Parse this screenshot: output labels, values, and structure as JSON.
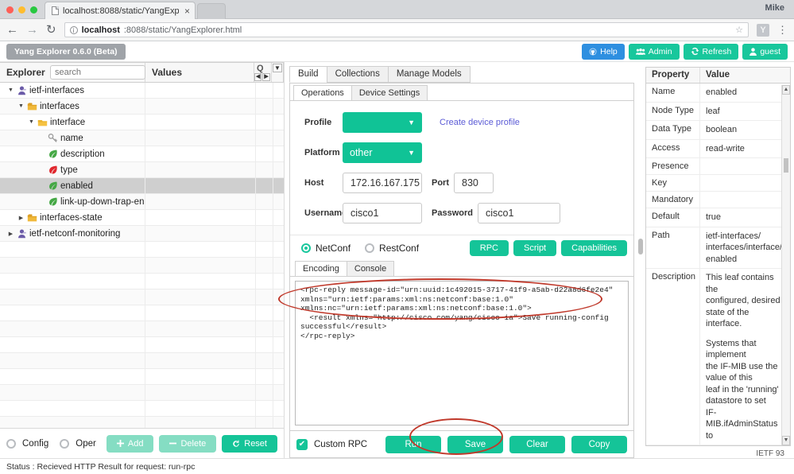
{
  "browser": {
    "tab_title": "localhost:8088/static/YangExp",
    "tab_close": "×",
    "profile": "Mike",
    "back": "←",
    "forward": "→",
    "reload": "↻",
    "info_glyph": "ⓘ",
    "url_host": "localhost",
    "url_rest": ":8088/static/YangExplorer.html",
    "star": "☆",
    "extension": "Y",
    "menu": "⋮"
  },
  "app_header": {
    "brand": "Yang Explorer 0.6.0 (Beta)",
    "buttons": [
      {
        "label": "Help",
        "icon": "github-icon",
        "color": "#2e8fe0"
      },
      {
        "label": "Admin",
        "icon": "users-icon",
        "color": "#18c79c"
      },
      {
        "label": "Refresh",
        "icon": "refresh-icon",
        "color": "#18c79c"
      },
      {
        "label": "guest",
        "icon": "user-icon",
        "color": "#18c79c"
      }
    ]
  },
  "explorer": {
    "title": "Explorer",
    "search_placeholder": "search",
    "search_value": "",
    "values_header": "Values",
    "spinner_glyph": "Q",
    "tree": [
      {
        "label": "ietf-interfaces",
        "indent": 0,
        "twisty": "▼",
        "icon": "module-icon"
      },
      {
        "label": "interfaces",
        "indent": 1,
        "twisty": "▼",
        "icon": "container-icon"
      },
      {
        "label": "interface",
        "indent": 2,
        "twisty": "▼",
        "icon": "list-icon"
      },
      {
        "label": "name",
        "indent": 3,
        "twisty": "",
        "icon": "key-icon"
      },
      {
        "label": "description",
        "indent": 3,
        "twisty": "",
        "icon": "leaf-green-icon"
      },
      {
        "label": "type",
        "indent": 3,
        "twisty": "",
        "icon": "leaf-red-icon"
      },
      {
        "label": "enabled",
        "indent": 3,
        "twisty": "",
        "icon": "leaf-green-icon",
        "selected": true
      },
      {
        "label": "link-up-down-trap-enable",
        "indent": 3,
        "twisty": "",
        "icon": "leaf-green-icon"
      },
      {
        "label": "interfaces-state",
        "indent": 1,
        "twisty": "▶",
        "icon": "container-icon"
      },
      {
        "label": "ietf-netconf-monitoring",
        "indent": 0,
        "twisty": "▶",
        "icon": "module-icon"
      }
    ],
    "footer": {
      "radios": [
        {
          "label": "Config",
          "selected": false
        },
        {
          "label": "Oper",
          "selected": false
        }
      ],
      "buttons": [
        {
          "label": "Add",
          "icon": "plus-icon",
          "enabled": false
        },
        {
          "label": "Delete",
          "icon": "minus-icon",
          "enabled": false
        },
        {
          "label": "Reset",
          "icon": "reset-icon",
          "enabled": true
        }
      ]
    }
  },
  "center": {
    "main_tabs": [
      {
        "label": "Build",
        "active": true
      },
      {
        "label": "Collections",
        "active": false
      },
      {
        "label": "Manage Models",
        "active": false
      }
    ],
    "sub_tabs": [
      {
        "label": "Operations",
        "active": true
      },
      {
        "label": "Device Settings",
        "active": false
      }
    ],
    "form": {
      "profile_label": "Profile",
      "profile_value": "",
      "create_profile_link": "Create device profile",
      "platform_label": "Platform",
      "platform_value": "other",
      "host_label": "Host",
      "host_value": "172.16.167.175",
      "port_label": "Port",
      "port_value": "830",
      "username_label": "Username",
      "username_value": "cisco1",
      "password_label": "Password",
      "password_value": "cisco1",
      "caret": "▼"
    },
    "protocol": {
      "options": [
        {
          "label": "NetConf",
          "selected": true
        },
        {
          "label": "RestConf",
          "selected": false
        }
      ],
      "buttons": [
        "RPC",
        "Script",
        "Capabilities"
      ]
    },
    "encoding_tabs": [
      {
        "label": "Encoding",
        "active": true
      },
      {
        "label": "Console",
        "active": false
      }
    ],
    "xml_output": "<rpc-reply message-id=\"urn:uuid:1c492015-3717-41f9-a5ab-d22a8d6fe2e4\"\nxmlns=\"urn:ietf:params:xml:ns:netconf:base:1.0\"\nxmlns:nc=\"urn:ietf:params:xml:ns:netconf:base:1.0\">\n  <result xmlns=\"http://cisco.com/yang/cisco-ia\">Save running-config\nsuccessful</result>\n</rpc-reply>",
    "footer": {
      "custom_rpc_label": "Custom RPC",
      "custom_rpc_checked": true,
      "check_glyph": "✔",
      "buttons": [
        "Run",
        "Save",
        "Clear",
        "Copy"
      ]
    }
  },
  "properties": {
    "headers": [
      "Property",
      "Value"
    ],
    "rows": [
      {
        "property": "Name",
        "value": "enabled"
      },
      {
        "property": "Node Type",
        "value": "leaf"
      },
      {
        "property": "Data Type",
        "value": "boolean"
      },
      {
        "property": "Access",
        "value": "read-write"
      },
      {
        "property": "Presence",
        "value": ""
      },
      {
        "property": "Key",
        "value": ""
      },
      {
        "property": "Mandatory",
        "value": ""
      },
      {
        "property": "Default",
        "value": "true"
      },
      {
        "property": "Path",
        "value": "ietf-interfaces/\ninterfaces/interface/\nenabled"
      },
      {
        "property": "Description",
        "value": "This leaf contains the\nconfigured, desired\nstate of the\ninterface.\n\nSystems that implement\nthe IF-MIB use the\nvalue of this\nleaf in the 'running'\ndatastore to set\nIF-MIB.ifAdminStatus to"
      }
    ],
    "scroll_up": "▲",
    "scroll_down": "▼",
    "footer_note": "IETF 93"
  },
  "statusbar": {
    "text": "Status : Recieved HTTP Result for request: run-rpc"
  }
}
